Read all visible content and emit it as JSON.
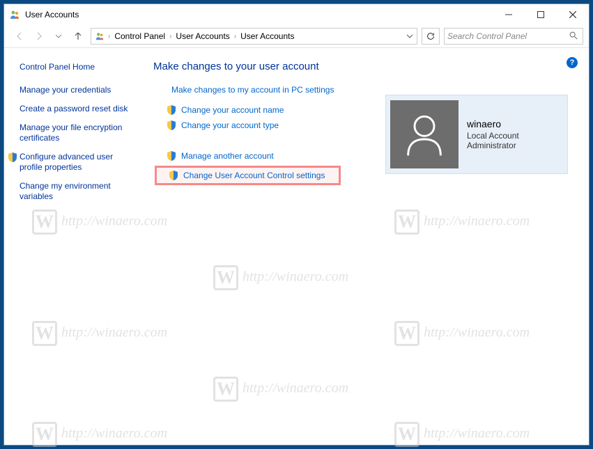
{
  "window": {
    "title": "User Accounts"
  },
  "titlebar_buttons": {
    "minimize": "minimize",
    "maximize": "maximize",
    "close": "close"
  },
  "breadcrumb": {
    "root": "Control Panel",
    "level1": "User Accounts",
    "level2": "User Accounts"
  },
  "search": {
    "placeholder": "Search Control Panel"
  },
  "sidebar": {
    "home": "Control Panel Home",
    "items": [
      {
        "label": "Manage your credentials",
        "shield": false
      },
      {
        "label": "Create a password reset disk",
        "shield": false
      },
      {
        "label": "Manage your file encryption certificates",
        "shield": false
      },
      {
        "label": "Configure advanced user profile properties",
        "shield": true
      },
      {
        "label": "Change my environment variables",
        "shield": false
      }
    ]
  },
  "main": {
    "heading": "Make changes to your user account",
    "pc_settings_link": "Make changes to my account in PC settings",
    "change_name": "Change your account name",
    "change_type": "Change your account type",
    "manage_another": "Manage another account",
    "uac_settings": "Change User Account Control settings"
  },
  "account": {
    "name": "winaero",
    "type": "Local Account",
    "role": "Administrator"
  },
  "watermark": {
    "text": "http://winaero.com",
    "badge": "W"
  }
}
